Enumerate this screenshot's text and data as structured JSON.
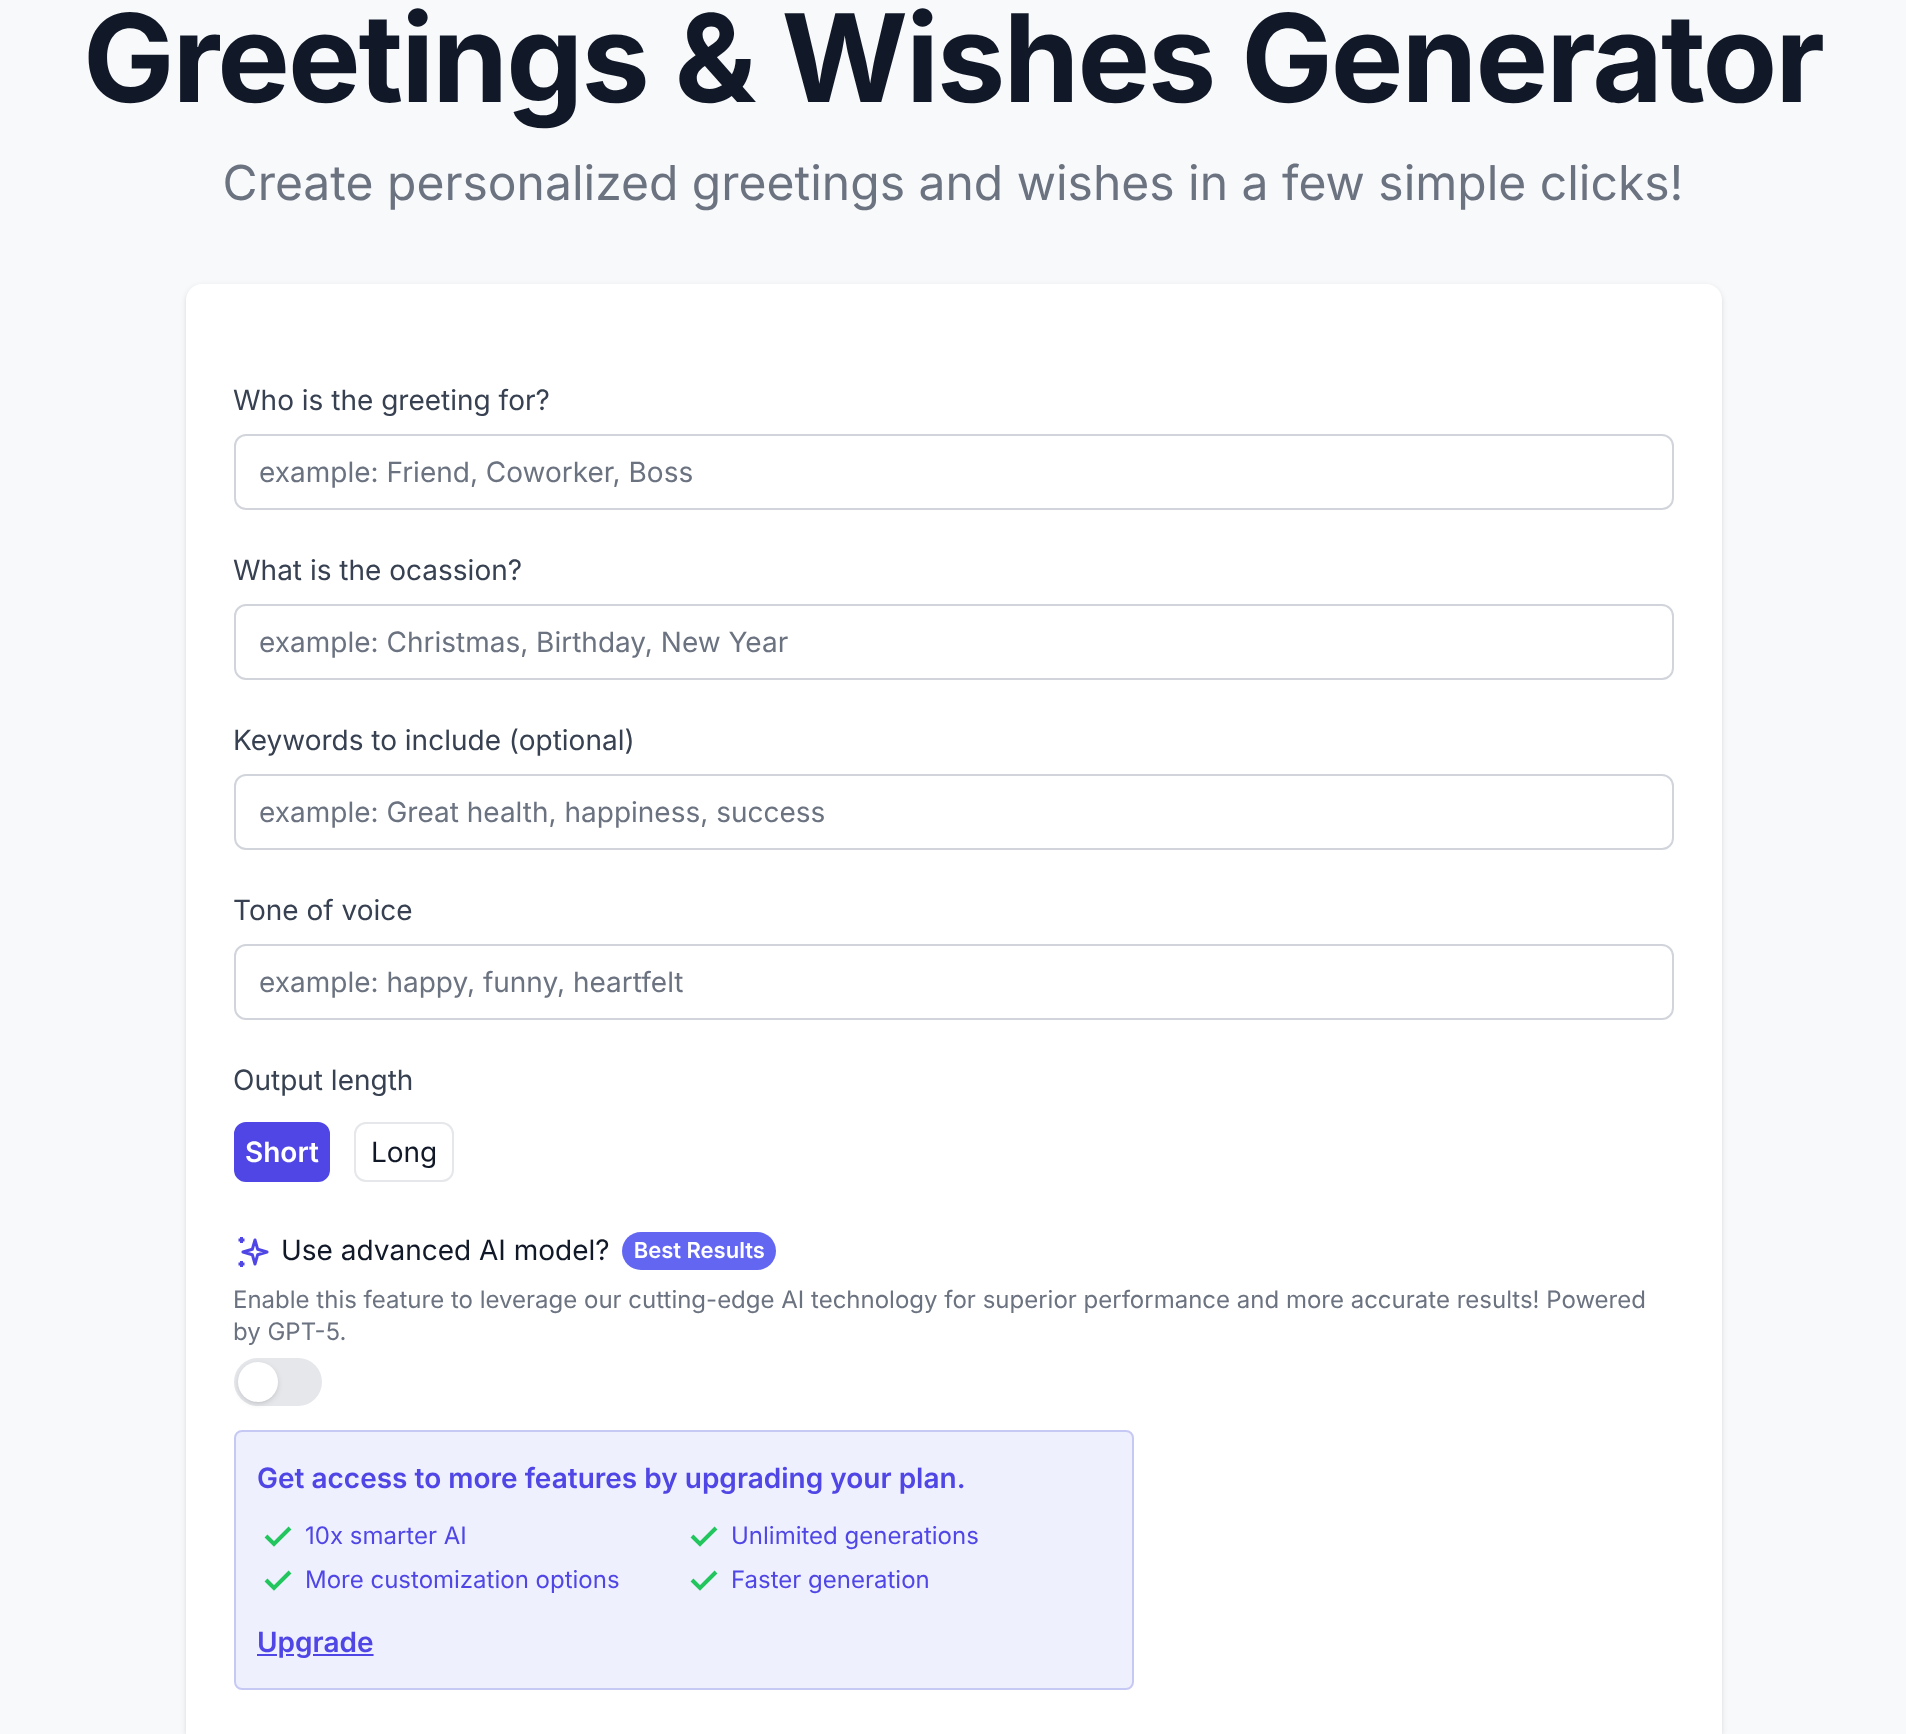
{
  "title": "Greetings & Wishes Generator",
  "subtitle": "Create personalized greetings and wishes in a few simple clicks!",
  "fields": [
    {
      "label": "Who is the greeting for?",
      "placeholder": "example: Friend, Coworker, Boss"
    },
    {
      "label": "What is the ocassion?",
      "placeholder": "example: Christmas, Birthday, New Year"
    },
    {
      "label": "Keywords to include (optional)",
      "placeholder": "example: Great health, happiness, success"
    },
    {
      "label": "Tone of voice",
      "placeholder": "example: happy, funny, heartfelt"
    }
  ],
  "output_length": {
    "label": "Output length",
    "options": [
      {
        "label": "Short",
        "selected": true
      },
      {
        "label": "Long",
        "selected": false
      }
    ]
  },
  "advanced": {
    "label": "Use advanced AI model?",
    "badge": "Best Results",
    "description": "Enable this feature to leverage our cutting-edge AI technology for superior performance and more accurate results! Powered by GPT-5.",
    "on": false
  },
  "upgrade": {
    "heading": "Get access to more features by upgrading your plan.",
    "features": [
      "10x smarter AI",
      "Unlimited generations",
      "More customization options",
      "Faster generation"
    ],
    "link": "Upgrade"
  }
}
